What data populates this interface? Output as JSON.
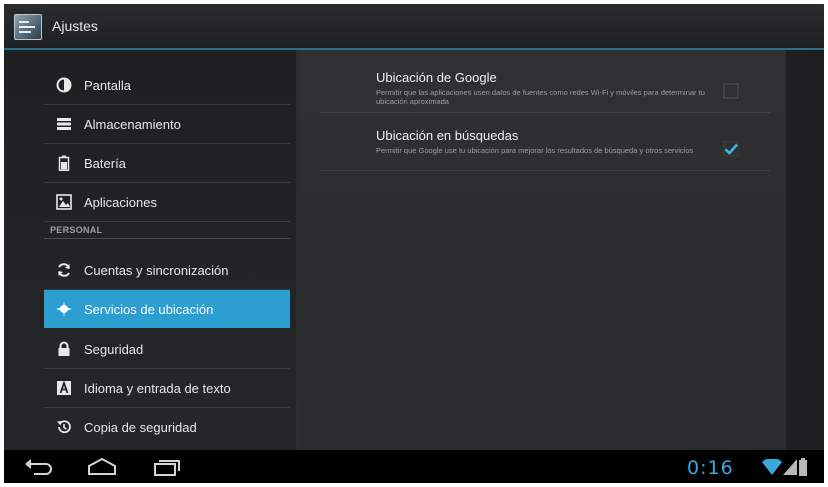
{
  "action_bar": {
    "title": "Ajustes",
    "icon": "settings-app-icon"
  },
  "sidebar": {
    "items_top": [
      {
        "label": "Pantalla",
        "icon": "display-icon"
      },
      {
        "label": "Almacenamiento",
        "icon": "storage-icon"
      },
      {
        "label": "Batería",
        "icon": "battery-icon"
      },
      {
        "label": "Aplicaciones",
        "icon": "apps-icon"
      }
    ],
    "section_header": "PERSONAL",
    "items_personal": [
      {
        "label": "Cuentas y sincronización",
        "icon": "sync-icon"
      },
      {
        "label": "Servicios de ubicación",
        "icon": "location-icon",
        "active": true
      },
      {
        "label": "Seguridad",
        "icon": "lock-icon"
      },
      {
        "label": "Idioma y entrada de texto",
        "icon": "language-icon"
      },
      {
        "label": "Copia de seguridad",
        "icon": "backup-icon"
      }
    ]
  },
  "detail": {
    "prefs": [
      {
        "title": "Ubicación de Google",
        "summary": "Permitir que las aplicaciones usen datos de fuentes como redes Wi-Fi y móviles para determinar tu ubicación aproximada",
        "checked": false
      },
      {
        "title": "Ubicación en búsquedas",
        "summary": "Permitir que Google use tu ubicación para mejorar los resultados de búsqueda y otros servicios",
        "checked": true
      }
    ]
  },
  "system_bar": {
    "clock": "0:16",
    "icons": [
      "back-icon",
      "home-icon",
      "recent-apps-icon",
      "wifi-icon",
      "signal-icon",
      "battery-status-icon"
    ]
  },
  "colors": {
    "accent": "#2c9ed0",
    "clock": "#3aa8dc",
    "action_bar_border": "#2f6f86"
  }
}
